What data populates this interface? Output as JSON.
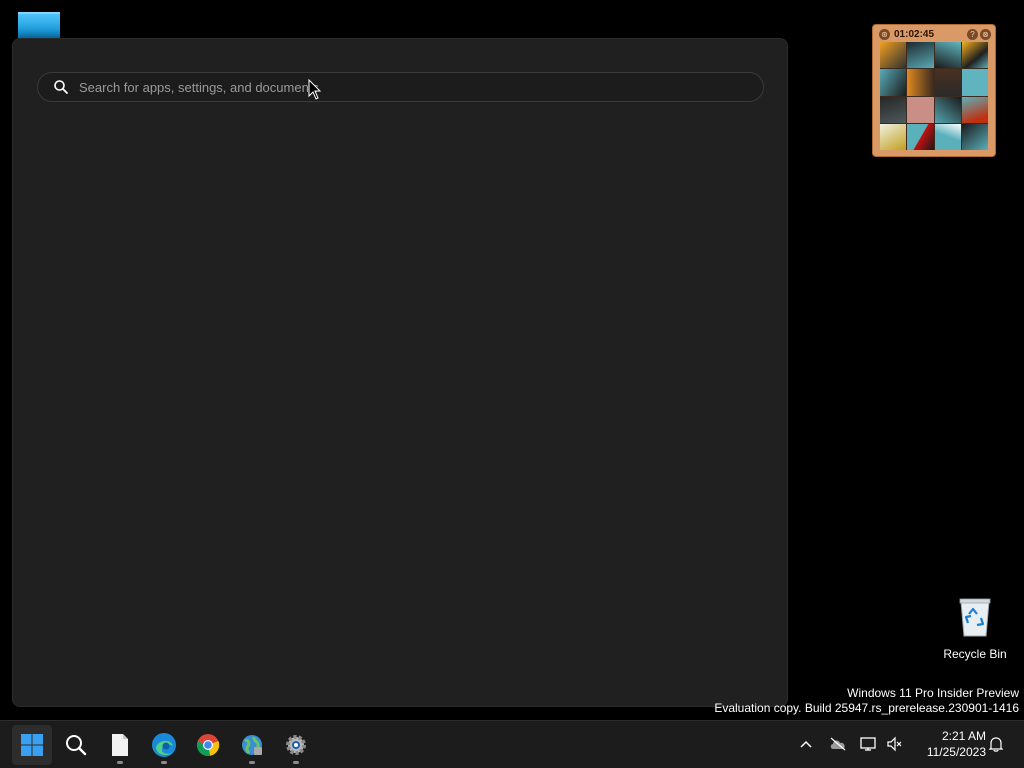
{
  "search": {
    "placeholder": "Search for apps, settings, and documents"
  },
  "puzzle_widget": {
    "timer": "01:02:45",
    "help_label": "?",
    "close_label": "⊗",
    "back_label": "⊛"
  },
  "desktop": {
    "recycle_bin_label": "Recycle Bin"
  },
  "watermark": {
    "line1": "Windows 11 Pro Insider Preview",
    "line2": "Evaluation copy. Build 25947.rs_prerelease.230901-1416"
  },
  "taskbar": {
    "apps": [
      {
        "name": "start-button",
        "icon": "windows-logo"
      },
      {
        "name": "search-button",
        "icon": "search-icon"
      },
      {
        "name": "file-explorer-button",
        "icon": "file-icon"
      },
      {
        "name": "edge-button",
        "icon": "edge-icon"
      },
      {
        "name": "chrome-button",
        "icon": "chrome-icon"
      },
      {
        "name": "network-app-button",
        "icon": "globe-icon"
      },
      {
        "name": "settings-button",
        "icon": "gear-icon"
      }
    ],
    "clock": {
      "time": "2:21 AM",
      "date": "11/25/2023"
    }
  },
  "colors": {
    "accent": "#0078d4",
    "panel_bg": "#202020",
    "taskbar_bg": "#1c1c1c",
    "puzzle_frame": "#d99a67"
  }
}
